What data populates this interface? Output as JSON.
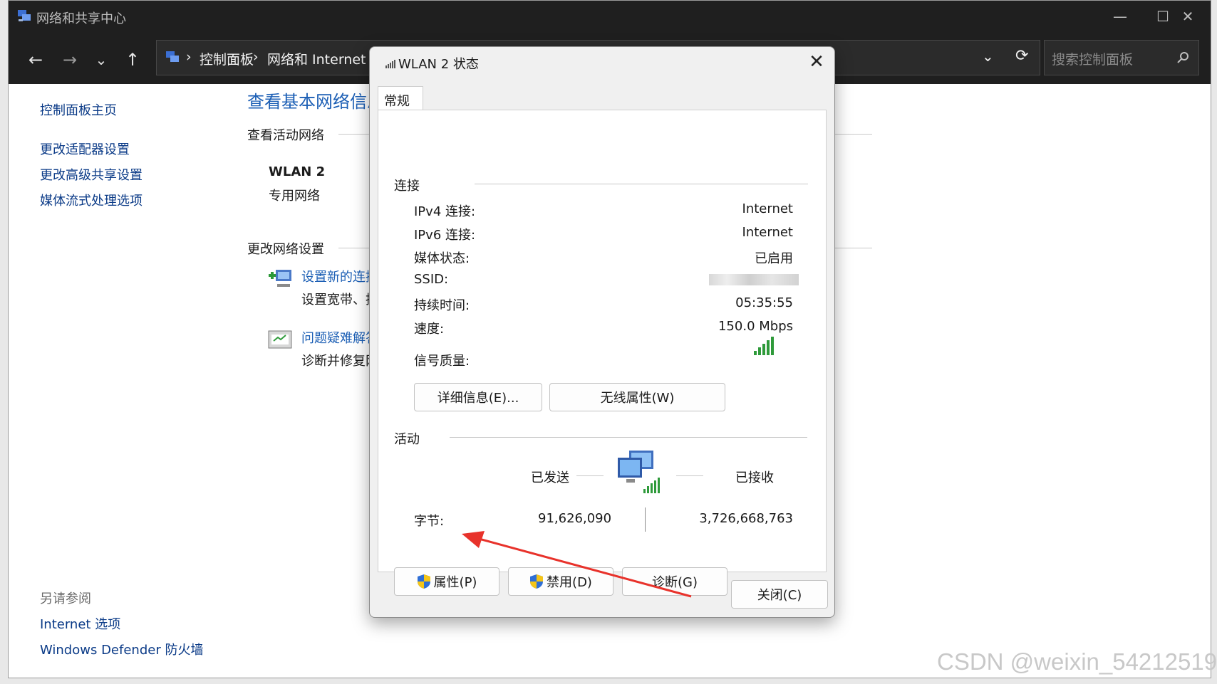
{
  "window": {
    "title": "网络和共享中心",
    "minimize": "—",
    "maximize": "☐",
    "close": "✕"
  },
  "nav": {
    "back": "←",
    "forward": "→",
    "recent": "⌄",
    "up": "↑",
    "breadcrumb": [
      "控制面板",
      "网络和 Internet"
    ],
    "sep": "›",
    "refresh": "⟳",
    "dropdown": "⌄",
    "search_placeholder": "搜索控制面板"
  },
  "sidebar": {
    "home": "控制面板主页",
    "items": [
      "更改适配器设置",
      "更改高级共享设置",
      "媒体流式处理选项"
    ],
    "see_also_title": "另请参阅",
    "see_also": [
      "Internet 选项",
      "Windows Defender 防火墙"
    ]
  },
  "main": {
    "heading": "查看基本网络信息",
    "active_networks": "查看活动网络",
    "network_name": "WLAN 2",
    "network_type": "专用网络",
    "change_settings": "更改网络设置",
    "task1_link": "设置新的连接或网络",
    "task1_desc": "设置宽带、拨号或 VPN 连接",
    "task2_link": "问题疑难解答",
    "task2_desc": "诊断并修复网络问题"
  },
  "dialog": {
    "title": "WLAN 2 状态",
    "close": "✕",
    "tab": "常规",
    "connection_section": "连接",
    "rows": [
      {
        "label": "IPv4 连接:",
        "value": "Internet"
      },
      {
        "label": "IPv6 连接:",
        "value": "Internet"
      },
      {
        "label": "媒体状态:",
        "value": "已启用"
      },
      {
        "label": "SSID:",
        "value": ""
      },
      {
        "label": "持续时间:",
        "value": "05:35:55"
      },
      {
        "label": "速度:",
        "value": "150.0 Mbps"
      }
    ],
    "signal_label": "信号质量:",
    "signal_bars": 5,
    "details_button": "详细信息(E)...",
    "wireless_button": "无线属性(W)",
    "activity_section": "活动",
    "sent_label": "已发送",
    "received_label": "已接收",
    "bytes_label": "字节:",
    "bytes_sent": "91,626,090",
    "bytes_received": "3,726,668,763",
    "properties_button": "属性(P)",
    "disable_button": "禁用(D)",
    "diagnose_button": "诊断(G)",
    "close_button": "关闭(C)"
  },
  "watermark": "CSDN @weixin_54212519",
  "colors": {
    "titlebar": "#1f1f1f",
    "link": "#0a3a87",
    "heading": "#1c5fb5",
    "annotation_arrow": "#e8322b",
    "signal": "#2e9a3a"
  }
}
